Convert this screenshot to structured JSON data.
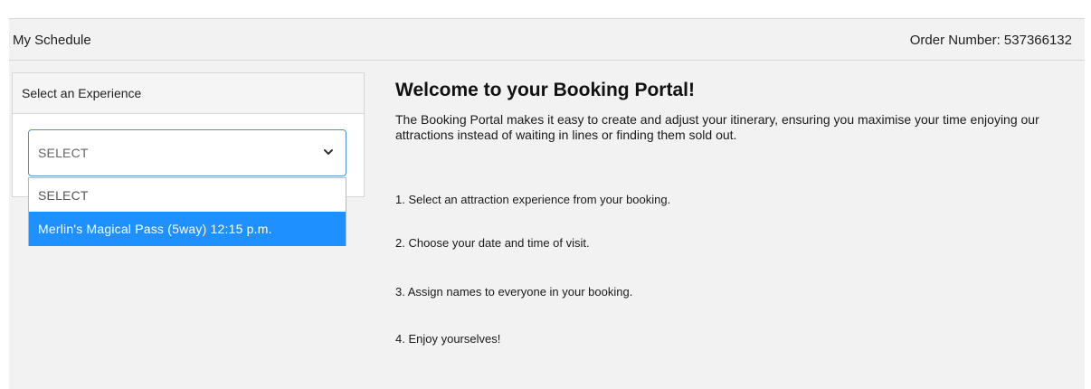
{
  "header": {
    "title": "My Schedule",
    "order_number": "Order Number: 537366132"
  },
  "experience": {
    "card_title": "Select an Experience",
    "select_value": "SELECT",
    "options": [
      "SELECT",
      "Merlin's Magical Pass (5way) 12:15 p.m."
    ],
    "highlighted_option_index": 1
  },
  "main": {
    "welcome_title": "Welcome to your Booking Portal!",
    "intro": "The Booking Portal makes it easy to create and adjust your itinerary, ensuring you maximise your time enjoying our attractions instead of waiting in lines or finding them sold out.",
    "steps": [
      "1. Select an attraction experience from your booking.",
      "2. Choose your date and time of visit.",
      "3. Assign names to everyone in your booking.",
      "4. Enjoy yourselves!"
    ]
  },
  "colors": {
    "highlight": "#1e90ff",
    "select_border": "#4a90e2",
    "panel_bg": "#f2f2f2"
  },
  "icons": {
    "select_arrow": "chevron-down-icon"
  }
}
